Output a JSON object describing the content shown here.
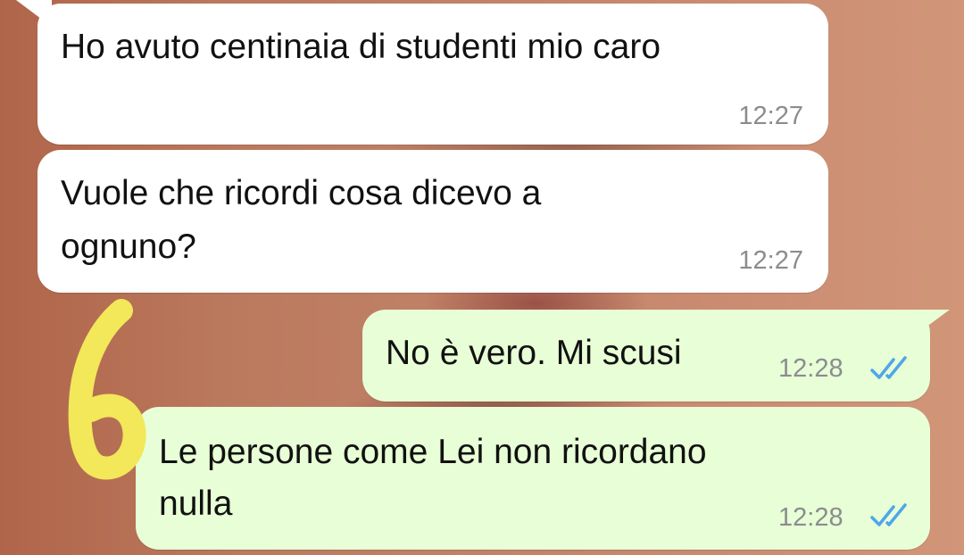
{
  "messages": [
    {
      "direction": "incoming",
      "text": "Ho avuto centinaia di studenti mio caro",
      "time": "12:27"
    },
    {
      "direction": "incoming",
      "text_lines": [
        "Vuole che ricordi cosa dicevo a",
        "ognuno?"
      ],
      "time": "12:27"
    },
    {
      "direction": "outgoing",
      "text": "No è vero. Mi scusi",
      "time": "12:28",
      "status": "read"
    },
    {
      "direction": "outgoing",
      "text_lines": [
        "Le persone come Lei non ricordano",
        "nulla"
      ],
      "time": "12:28",
      "status": "read"
    }
  ],
  "annotation": {
    "label": "6",
    "color": "#f3e75a"
  },
  "colors": {
    "incoming_bubble": "#ffffff",
    "outgoing_bubble": "#e8fed6",
    "read_check": "#4fa6ea",
    "timestamp": "#8a8d8f"
  }
}
